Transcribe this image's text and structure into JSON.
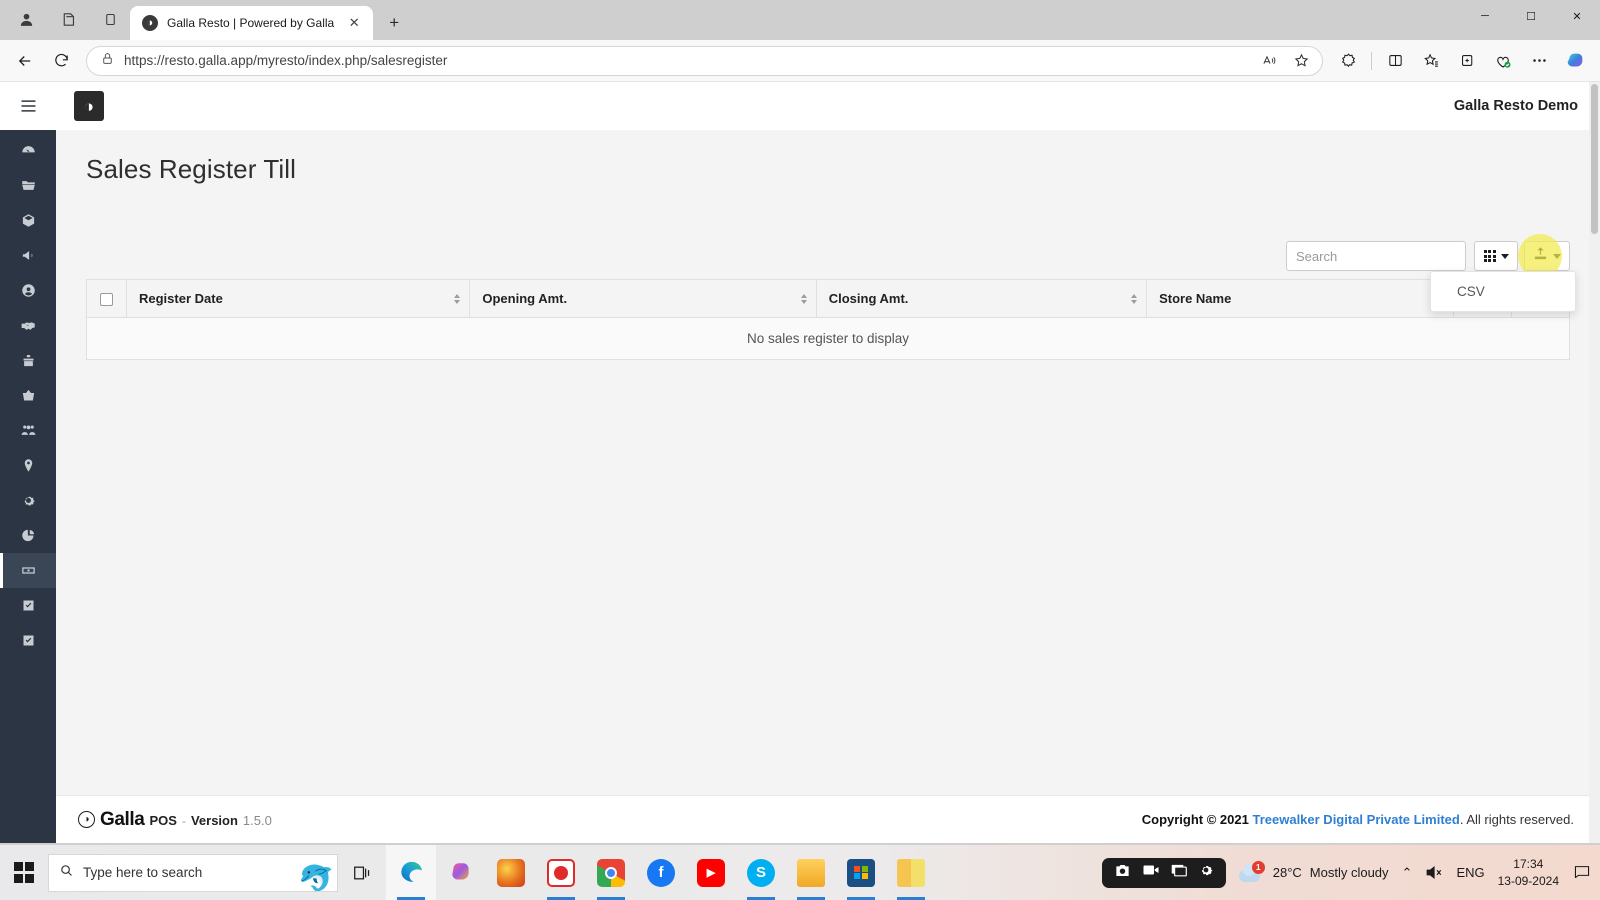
{
  "browser": {
    "tab": {
      "title": "Galla Resto | Powered by Galla",
      "favicon": "galla-logo-icon",
      "close": "✕"
    },
    "newtab_label": "+",
    "toolbar_icons": {
      "profile": "person-icon",
      "collections_left": "copilot-pages-icon",
      "split": "tab-panel-icon"
    },
    "window_controls": {
      "minimize": "─",
      "maximize": "☐",
      "close": "✕"
    },
    "nav": {
      "back": "←",
      "reload": "⟳"
    },
    "address": {
      "lock_icon": "lock-icon",
      "url": "https://resto.galla.app/myresto/index.php/salesregister",
      "read_aloud": "read-aloud-icon",
      "favorite": "star-icon"
    },
    "right_icons": [
      "extensions-icon",
      "split-screen-icon",
      "favorites-icon",
      "collections-icon",
      "browser-essentials-icon",
      "settings-more-icon",
      "copilot-icon"
    ]
  },
  "app": {
    "hamburger": "hamburger-menu-icon",
    "logo": "galla-brand-logo",
    "user": "Galla Resto Demo",
    "page_title": "Sales Register Till"
  },
  "sidebar": {
    "items": [
      {
        "icon": "dashboard-icon",
        "name": "dashboard",
        "active": false
      },
      {
        "icon": "folder-icon",
        "name": "catalog",
        "active": false
      },
      {
        "icon": "box-icon",
        "name": "products",
        "active": false
      },
      {
        "icon": "bullhorn-icon",
        "name": "marketing",
        "active": false
      },
      {
        "icon": "user-circle-icon",
        "name": "customers",
        "active": false
      },
      {
        "icon": "handshake-icon",
        "name": "suppliers",
        "active": false
      },
      {
        "icon": "gift-icon",
        "name": "offers",
        "active": false
      },
      {
        "icon": "basket-icon",
        "name": "sales",
        "active": false
      },
      {
        "icon": "users-icon",
        "name": "staff",
        "active": false
      },
      {
        "icon": "map-marker-icon",
        "name": "stores",
        "active": false
      },
      {
        "icon": "gear-icon",
        "name": "settings",
        "active": false
      },
      {
        "icon": "pie-chart-icon",
        "name": "reports",
        "active": false
      },
      {
        "icon": "cash-icon",
        "name": "sales-register",
        "active": true
      },
      {
        "icon": "check-square-icon",
        "name": "tasks",
        "active": false
      },
      {
        "icon": "check-square-icon",
        "name": "approvals",
        "active": false
      }
    ]
  },
  "toolbar": {
    "search_placeholder": "Search",
    "search_value": "",
    "columns_button": "columns-grid-icon",
    "export_button": "export-icon",
    "export_menu": {
      "items": [
        "CSV"
      ]
    },
    "highlight_color": "#f2ec4e"
  },
  "table": {
    "select_all": "select-all-checkbox",
    "columns": [
      {
        "label": "Register Date",
        "sortable": true
      },
      {
        "label": "Opening Amt.",
        "sortable": true
      },
      {
        "label": "Closing Amt.",
        "sortable": true
      },
      {
        "label": "Store Name",
        "sortable": false
      }
    ],
    "extra_columns": [
      "",
      ""
    ],
    "empty_message": "No sales register to display",
    "rows": []
  },
  "footer": {
    "mark": "galla-mark-icon",
    "brand": "Galla",
    "product": "POS",
    "dash": "-",
    "version_label": "Version",
    "version_number": "1.5.0",
    "copyright_prefix": "Copyright © 2021",
    "company": "Treewalker Digital Private Limited",
    "copyright_suffix": ". All rights reserved.",
    "link_color": "#2f7fd4"
  },
  "taskbar": {
    "start": "windows-start-icon",
    "search_placeholder": "Type here to search",
    "search_icon": "search-icon",
    "mascot": "dolphin-icon",
    "task_view": "task-view-icon",
    "apps": [
      {
        "name": "edge",
        "label": "e",
        "color": "#0f7dc2",
        "open": true,
        "active": true
      },
      {
        "name": "copilot",
        "label": "",
        "color": "#b14ae0",
        "open": false,
        "active": false
      },
      {
        "name": "firefox",
        "label": "",
        "color": "#e5721d",
        "open": false,
        "active": false
      },
      {
        "name": "screen-recorder",
        "label": "",
        "color": "#e02b2b",
        "open": true,
        "active": false
      },
      {
        "name": "chrome",
        "label": "",
        "color": "#2e8b44",
        "open": true,
        "active": false
      },
      {
        "name": "facebook",
        "label": "f",
        "color": "#1877f2",
        "open": false,
        "active": false
      },
      {
        "name": "youtube",
        "label": "▶",
        "color": "#ff0000",
        "open": false,
        "active": false
      },
      {
        "name": "skype",
        "label": "S",
        "color": "#00aff0",
        "open": true,
        "active": false
      },
      {
        "name": "file-explorer",
        "label": "",
        "color": "#ffc107",
        "open": true,
        "active": false
      },
      {
        "name": "microsoft-store",
        "label": "",
        "color": "#1b4e82",
        "open": true,
        "active": false
      },
      {
        "name": "paint-app",
        "label": "",
        "color": "#f0b429",
        "open": true,
        "active": false
      }
    ],
    "recorder": {
      "camera": "camera-icon",
      "video": "video-icon",
      "window": "window-icon",
      "settings": "gear-icon"
    },
    "weather": {
      "temperature": "28°C",
      "condition": "Mostly cloudy",
      "badge": "1"
    },
    "tray": {
      "chevron": "⌃",
      "volume": "volume-muted-icon",
      "language": "ENG"
    },
    "clock": {
      "time": "17:34",
      "date": "13-09-2024"
    },
    "notifications": "notification-icon"
  }
}
